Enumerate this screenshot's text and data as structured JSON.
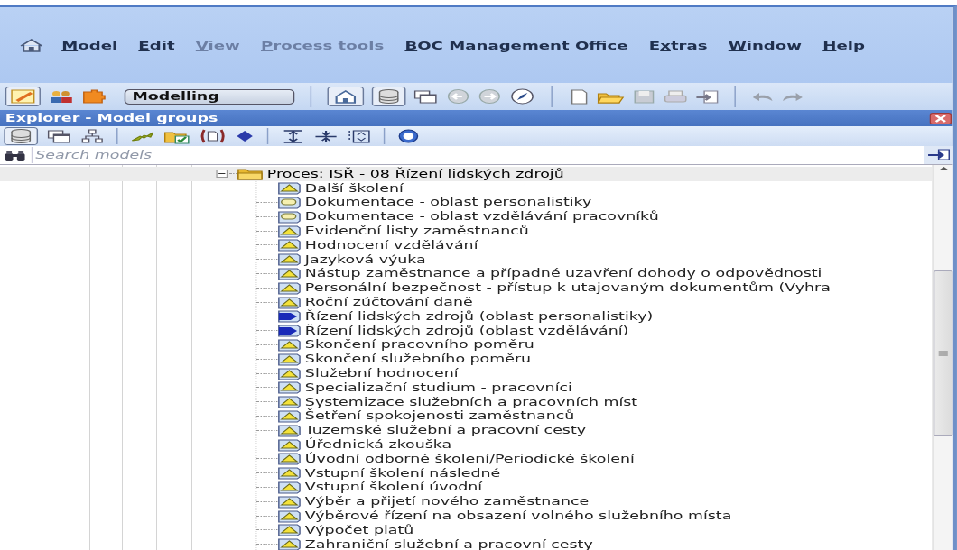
{
  "menu": [
    {
      "key": "M",
      "post": "odel",
      "disabled": false
    },
    {
      "key": "E",
      "post": "dit",
      "disabled": false
    },
    {
      "key": "V",
      "post": "iew",
      "disabled": true
    },
    {
      "key": "P",
      "post": "rocess tools",
      "disabled": true
    },
    {
      "key": "B",
      "post": "OC Management Office",
      "disabled": false
    },
    {
      "pre": "E",
      "key": "x",
      "post": "tras",
      "disabled": false
    },
    {
      "key": "W",
      "post": "indow",
      "disabled": false
    },
    {
      "key": "H",
      "post": "elp",
      "disabled": false
    }
  ],
  "toolbar": {
    "mode": "Modelling"
  },
  "explorer": {
    "title": "Explorer - Model groups",
    "search": {
      "placeholder": "Search models"
    },
    "tree": {
      "label": "Proces: ISŘ - 08 Řízení lidských zdrojů",
      "kind": "folder",
      "expanded": true,
      "selected": true,
      "children": [
        {
          "label": "Další školení",
          "kind": "process",
          "selected": false
        },
        {
          "label": "Dokumentace - oblast personalistiky",
          "kind": "document",
          "selected": false
        },
        {
          "label": "Dokumentace - oblast vzdělávání pracovníků",
          "kind": "document",
          "selected": false
        },
        {
          "label": "Evidenční listy zaměstnanců",
          "kind": "process",
          "selected": false
        },
        {
          "label": "Hodnocení vzdělávání",
          "kind": "process",
          "selected": false
        },
        {
          "label": "Jazyková výuka",
          "kind": "process",
          "selected": false
        },
        {
          "label": "Nástup zaměstnance a případné uzavření dohody o odpovědnosti",
          "kind": "process",
          "selected": false
        },
        {
          "label": "Personální bezpečnost - přístup k utajovaným dokumentům (Vyhra",
          "kind": "process",
          "selected": false
        },
        {
          "label": "Roční zúčtování daně",
          "kind": "process",
          "selected": false
        },
        {
          "label": "Řízení lidských zdrojů (oblast personalistiky)",
          "kind": "map",
          "selected": false
        },
        {
          "label": "Řízení lidských zdrojů (oblast vzdělávání)",
          "kind": "map",
          "selected": false
        },
        {
          "label": "Skončení pracovního poměru",
          "kind": "process",
          "selected": false
        },
        {
          "label": "Skončení služebního poměru",
          "kind": "process",
          "selected": false
        },
        {
          "label": "Služební hodnocení",
          "kind": "process",
          "selected": false
        },
        {
          "label": "Specializační studium - pracovníci",
          "kind": "process",
          "selected": false
        },
        {
          "label": "Systemizace služebních a pracovních míst",
          "kind": "process",
          "selected": false
        },
        {
          "label": "Šetření spokojenosti zaměstnanců",
          "kind": "process",
          "selected": false
        },
        {
          "label": "Tuzemské služební a pracovní cesty",
          "kind": "process",
          "selected": false
        },
        {
          "label": "Úřednická zkouška",
          "kind": "process",
          "selected": false
        },
        {
          "label": "Úvodní odborné školení/Periodické školení",
          "kind": "process",
          "selected": false
        },
        {
          "label": "Vstupní školení následné",
          "kind": "process",
          "selected": false
        },
        {
          "label": "Vstupní školení úvodní",
          "kind": "process",
          "selected": false
        },
        {
          "label": "Výběr a přijetí nového zaměstnance",
          "kind": "process",
          "selected": false
        },
        {
          "label": "Výběrové řízení  na  obsazení volného služebního místa",
          "kind": "process",
          "selected": false
        },
        {
          "label": "Výpočet platů",
          "kind": "process",
          "selected": false
        },
        {
          "label": "Zahraniční služební a pracovní cesty",
          "kind": "process",
          "selected": false
        }
      ]
    }
  }
}
